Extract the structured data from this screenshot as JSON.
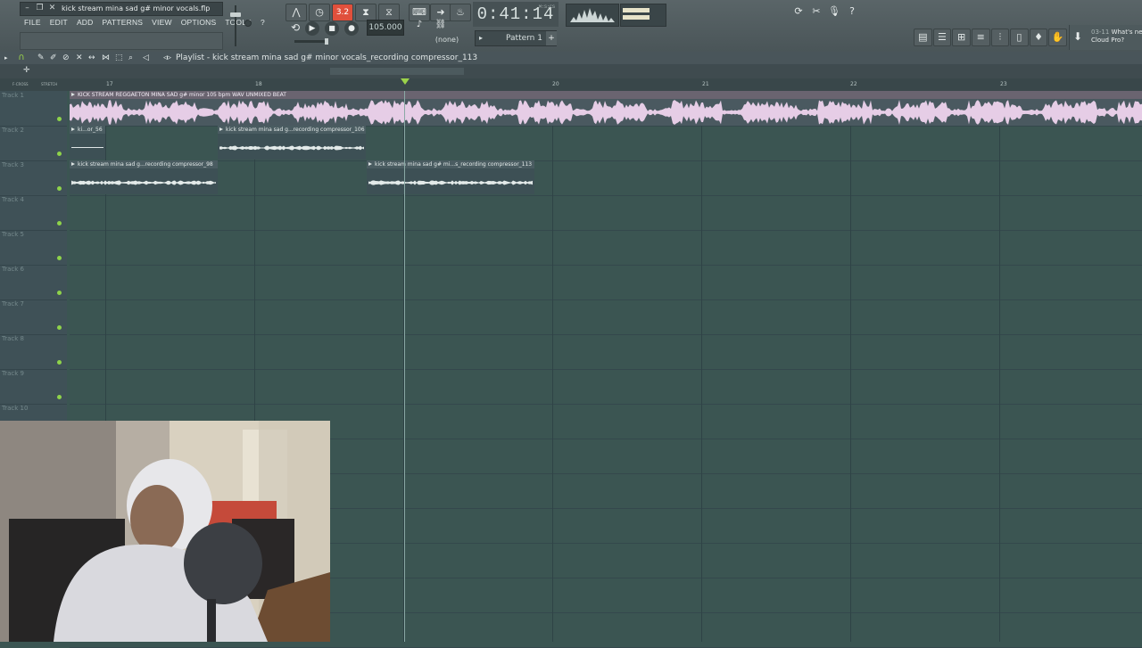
{
  "window": {
    "file_title": "kick stream mina sad g# minor vocals.flp"
  },
  "menu": [
    "FILE",
    "EDIT",
    "ADD",
    "PATTERNS",
    "VIEW",
    "OPTIONS",
    "TOOLS",
    "?"
  ],
  "transport": {
    "pat_song_label": "3.2",
    "tempo": "105.000",
    "time": "0:41:14",
    "time_unit": "M:S:CS",
    "pattern": "Pattern 1",
    "none_label": "(none)"
  },
  "news": {
    "date": "03-11",
    "line1": "What's new",
    "line2": "Cloud Pro?"
  },
  "playlist": {
    "title": "Playlist - kick stream mina sad g# minor vocals_recording compressor_113",
    "bar_labels": [
      "17",
      "18",
      "20",
      "21",
      "22",
      "23"
    ],
    "tracks": [
      "Track 1",
      "Track 2",
      "Track 3",
      "Track 4",
      "Track 5",
      "Track 6",
      "Track 7",
      "Track 8",
      "Track 9",
      "Track 10"
    ],
    "clips": {
      "beat": "KICK STREAM REGGAETON MINA SAD g# minor 105 bpm WAV UNMIXED BEAT",
      "t2a": "ki...or_56",
      "t2b": "kick stream mina sad g...recording compressor_106",
      "t3a": "kick stream mina sad g...recording compressor_98",
      "t3b": "kick stream mina sad g# mi...s_recording compressor_113"
    }
  },
  "colors": {
    "playlist_bg": "#3b5552",
    "beat_clip_header": "#6a6470",
    "waveform_pink": "#e6cde6",
    "track_led": "#8ed34a",
    "pat_song_accent": "#e0503c"
  },
  "icons": [
    "minimize-icon",
    "restore-icon",
    "close-icon",
    "play-icon",
    "stop-icon",
    "record-icon",
    "loop-icon",
    "metronome-icon",
    "pencil-icon",
    "paint-icon",
    "delete-icon",
    "mute-icon",
    "slice-icon",
    "select-icon",
    "zoom-icon",
    "playback-icon",
    "mixer-icon",
    "piano-roll-icon",
    "channel-rack-icon",
    "browser-icon",
    "plugin-icon",
    "download-icon",
    "help-icon",
    "cpu-icon"
  ]
}
